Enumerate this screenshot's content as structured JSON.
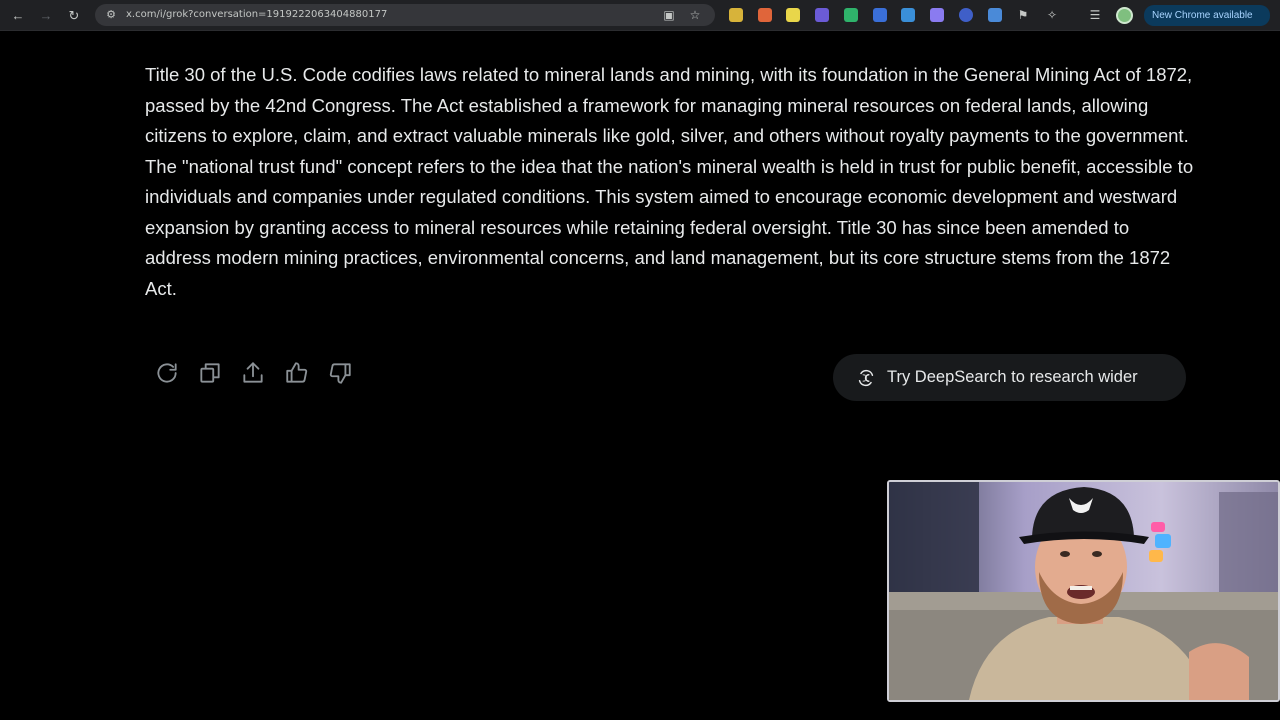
{
  "browser": {
    "url": "x.com/i/grok?conversation=1919222063404880177",
    "update_notice": "New Chrome available"
  },
  "answer": {
    "text": "Title 30 of the U.S. Code codifies laws related to mineral lands and mining, with its foundation in the General Mining Act of 1872, passed by the 42nd Congress. The Act established a framework for managing mineral resources on federal lands, allowing citizens to explore, claim, and extract valuable minerals like gold, silver, and others without royalty payments to the government. The \"national trust fund\" concept refers to the idea that the nation's mineral wealth is held in trust for public benefit, accessible to individuals and companies under regulated conditions. This system aimed to encourage economic development and westward expansion by granting access to mineral resources while retaining federal oversight. Title 30 has since been amended to address modern mining practices, environmental concerns, and land management, but its core structure stems from the 1872 Act."
  },
  "actions": {
    "icons": [
      "regenerate-icon",
      "copy-icon",
      "share-icon",
      "thumbs-up-icon",
      "thumbs-down-icon"
    ]
  },
  "deepsearch": {
    "label": "Try DeepSearch to research wider",
    "icon": "deepsearch-icon"
  },
  "colors": {
    "background": "#000000",
    "text": "#e7e9ea",
    "button_bg": "#181a1c",
    "chrome_bar": "#202124"
  }
}
